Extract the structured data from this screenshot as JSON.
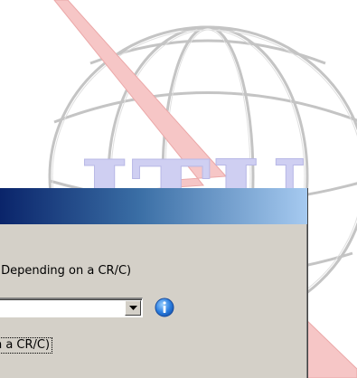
{
  "dialog": {
    "instruction_text": "(Depending on a CR/C)",
    "checkbox_label": "on a CR/C)",
    "combo_value": ""
  },
  "icons": {
    "dropdown": "chevron-down-icon",
    "info": "info-icon"
  },
  "colors": {
    "dialog_bg": "#d4d0c8",
    "titlebar_start": "#0a246a",
    "titlebar_end": "#a6caf0",
    "logo_text": "#c8c8f0",
    "logo_lines": "#c0c0c0",
    "logo_wing": "#f4b8b8"
  },
  "background": {
    "logo_text": "ITU"
  }
}
